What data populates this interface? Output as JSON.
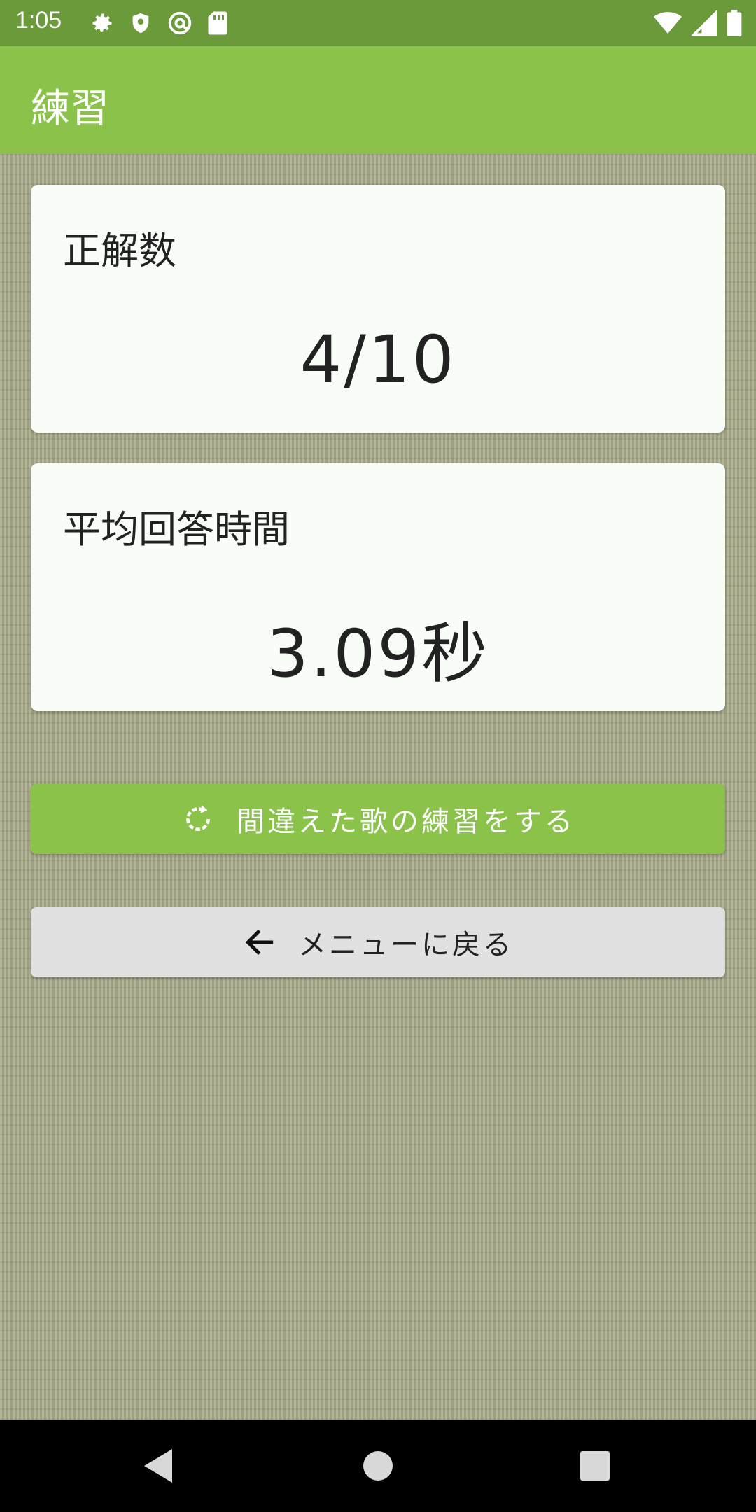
{
  "status_bar": {
    "time": "1:05",
    "icons_left": [
      "gear-icon",
      "shield-icon",
      "at-sign-icon",
      "sd-card-icon"
    ],
    "icons_right": [
      "wifi-icon",
      "signal-icon",
      "battery-icon"
    ]
  },
  "app_bar": {
    "title": "練習"
  },
  "cards": [
    {
      "label": "正解数",
      "value": "4/10"
    },
    {
      "label": "平均回答時間",
      "value": "3.09秒"
    }
  ],
  "buttons": {
    "retry_label": "間違えた歌の練習をする",
    "retry_icon": "refresh-icon",
    "back_label": "メニューに戻る",
    "back_icon": "arrow-left-icon"
  },
  "nav_bar": {
    "icons": [
      "back-icon",
      "home-icon",
      "recents-icon"
    ]
  },
  "colors": {
    "status_bar": "#6b9a3b",
    "app_bar": "#8bc34a",
    "primary_button": "#8bc34a",
    "secondary_button": "#e1e1e1",
    "background_pattern": "#a9aa88",
    "card": "#f8fdf8"
  }
}
